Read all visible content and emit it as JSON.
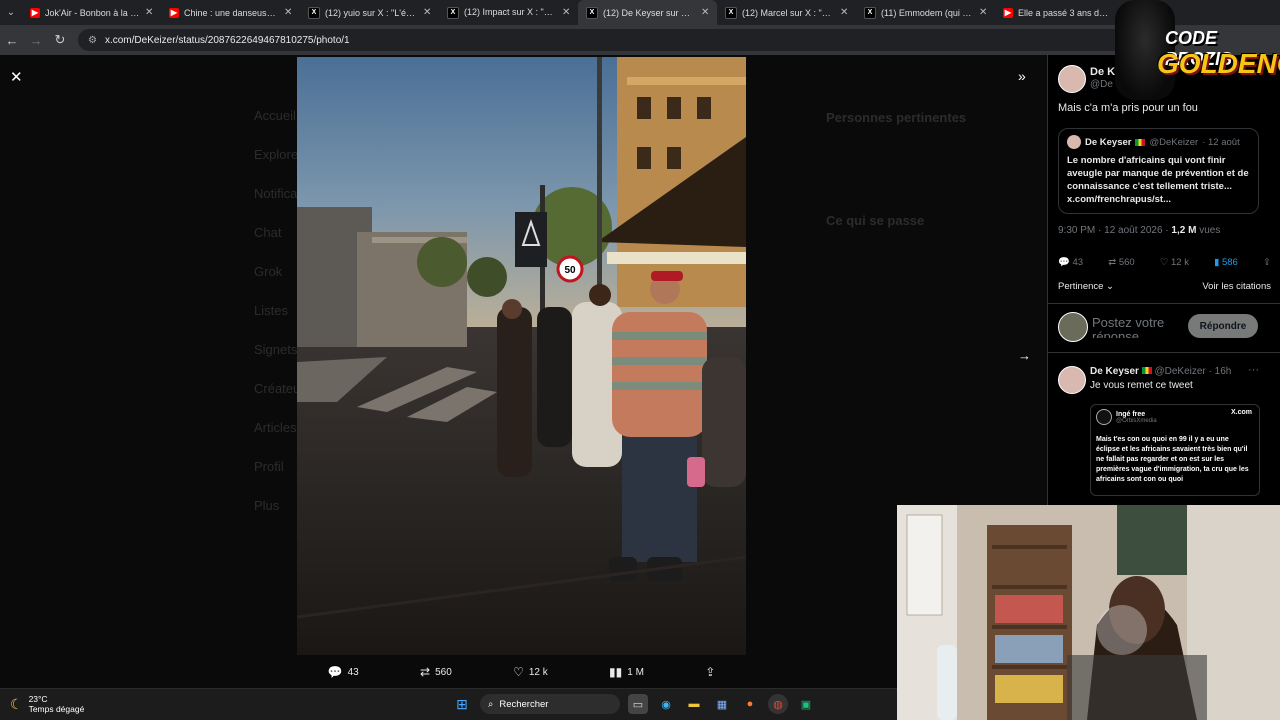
{
  "tabs": [
    {
      "title": "Jok'Air - Bonbon à la me",
      "fav": "yt",
      "active": false
    },
    {
      "title": "Chine : une danseuse gri",
      "fav": "yt",
      "active": false
    },
    {
      "title": "(12) yuio sur X : \"L'éclipse",
      "fav": "x",
      "active": false
    },
    {
      "title": "(12) Impact sur X : \"🌋 rel",
      "fav": "x",
      "active": false
    },
    {
      "title": "(12) De Keyser sur X : \"",
      "fav": "x",
      "active": true
    },
    {
      "title": "(12) Marcel sur X : \"Les p",
      "fav": "x",
      "active": false
    },
    {
      "title": "(11) Emmodem (qui doit",
      "fav": "x",
      "active": false
    },
    {
      "title": "Elle a passé 3 ans dans la",
      "fav": "yt",
      "active": false
    }
  ],
  "address": {
    "url": "x.com/DeKeizer/status/2087622649467810275/photo/1"
  },
  "ghost_nav": [
    "Accueil",
    "Explorer",
    "Notifications",
    "Chat",
    "Grok",
    "Listes",
    "Signets",
    "Créateurs",
    "Articles",
    "Profil",
    "Plus"
  ],
  "ghost_right": {
    "title1": "Personnes pertinentes",
    "title2": "Ce qui se passe"
  },
  "actions": {
    "replies": "43",
    "reposts": "560",
    "likes": "12 k",
    "views": "1 M"
  },
  "panel": {
    "author_short": "De K",
    "handle_short": "@De",
    "tweet_text": "Mais c'a m'a pris pour un fou",
    "quote": {
      "name": "De Keyser",
      "handle": "@DeKeizer",
      "date": "· 12 août",
      "text": "Le nombre d'africains qui vont finir aveugle par manque de prévention et de connaissance c'est tellement triste... x.com/frenchrapus/st..."
    },
    "meta_time": "9:30 PM · 12 août 2026 · ",
    "meta_views_num": "1,2 M",
    "meta_views_label": " vues",
    "stats": {
      "replies": "43",
      "reposts": "560",
      "likes": "12 k",
      "bookmarks": "586"
    },
    "sort_label": "Pertinence",
    "quotes_link": "Voir les citations",
    "reply_placeholder": "Postez votre réponse",
    "reply_button": "Répondre",
    "tweet2": {
      "name": "De Keyser",
      "handle": "@DeKeizer · 16h",
      "text": "Je vous remet ce tweet",
      "embed_name": "Ingé free",
      "embed_handle": "@OrbisXmedia",
      "embed_site": "X.com",
      "embed_text": "Mais t'es con ou quoi en 99 il y a eu une éclipse et les africains savaient très bien qu'il ne fallait pas regarder et on est sur les premières vague d'immigration, ta cru que les africains sont con ou quoi"
    }
  },
  "overlay_logo": {
    "line1": "CODE PROZIS",
    "line2": "GOLDENG"
  },
  "photo_sign": "50",
  "taskbar": {
    "temp": "23°C",
    "weather": "Temps dégagé",
    "search": "Rechercher"
  }
}
